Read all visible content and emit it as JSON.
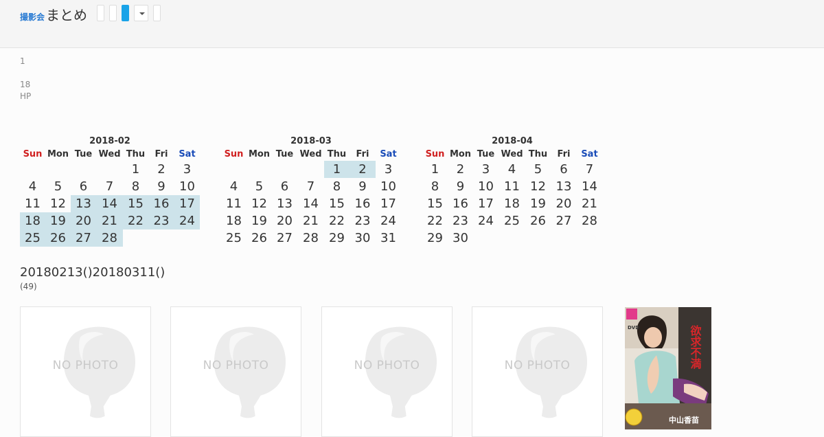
{
  "header": {
    "brand_small": "撮影会",
    "brand_main": "まとめ"
  },
  "info": {
    "line1": "1",
    "line2": "18",
    "line3": "HP"
  },
  "weekdays": [
    "Sun",
    "Mon",
    "Tue",
    "Wed",
    "Thu",
    "Fri",
    "Sat"
  ],
  "calendars": [
    {
      "title": "2018-02",
      "weeks": [
        [
          "",
          "",
          "",
          "",
          "1",
          "2",
          "3"
        ],
        [
          "4",
          "5",
          "6",
          "7",
          "8",
          "9",
          "10"
        ],
        [
          "11",
          "12",
          "13",
          "14",
          "15",
          "16",
          "17"
        ],
        [
          "18",
          "19",
          "20",
          "21",
          "22",
          "23",
          "24"
        ],
        [
          "25",
          "26",
          "27",
          "28",
          "",
          "",
          ""
        ]
      ],
      "highlighted": [
        "13",
        "14",
        "15",
        "16",
        "17",
        "18",
        "19",
        "20",
        "21",
        "22",
        "23",
        "24",
        "25",
        "26",
        "27",
        "28"
      ]
    },
    {
      "title": "2018-03",
      "weeks": [
        [
          "",
          "",
          "",
          "",
          "1",
          "2",
          "3"
        ],
        [
          "4",
          "5",
          "6",
          "7",
          "8",
          "9",
          "10"
        ],
        [
          "11",
          "12",
          "13",
          "14",
          "15",
          "16",
          "17"
        ],
        [
          "18",
          "19",
          "20",
          "21",
          "22",
          "23",
          "24"
        ],
        [
          "25",
          "26",
          "27",
          "28",
          "29",
          "30",
          "31"
        ]
      ],
      "highlighted": [
        "1",
        "2"
      ]
    },
    {
      "title": "2018-04",
      "weeks": [
        [
          "1",
          "2",
          "3",
          "4",
          "5",
          "6",
          "7"
        ],
        [
          "8",
          "9",
          "10",
          "11",
          "12",
          "13",
          "14"
        ],
        [
          "15",
          "16",
          "17",
          "18",
          "19",
          "20",
          "21"
        ],
        [
          "22",
          "23",
          "24",
          "25",
          "26",
          "27",
          "28"
        ],
        [
          "29",
          "30",
          "",
          "",
          "",
          "",
          ""
        ]
      ],
      "highlighted": []
    }
  ],
  "period": "20180213()20180311()",
  "count": "(49)",
  "cards": [
    {
      "label": "NO PHOTO"
    },
    {
      "label": "NO PHOTO"
    },
    {
      "label": "NO PHOTO"
    },
    {
      "label": "NO PHOTO"
    }
  ],
  "cover": {
    "title_text": "欲求不満",
    "actress": "中山香苗",
    "badge": "DVD"
  },
  "colors": {
    "accent": "#1aa3e8",
    "brand": "#2b7cd3",
    "highlight": "#cde3ea",
    "sunday": "#d02020",
    "saturday": "#1a4cb8"
  }
}
